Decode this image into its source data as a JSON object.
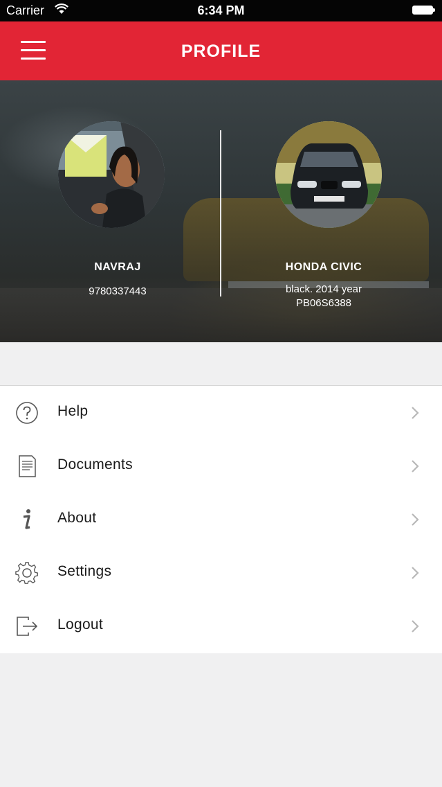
{
  "status_bar": {
    "carrier": "Carrier",
    "time": "6:34 PM"
  },
  "header": {
    "title": "PROFILE"
  },
  "profile": {
    "driver_name": "NAVRAJ",
    "driver_phone": "9780337443",
    "car_name": "HONDA CIVIC",
    "car_description": "black. 2014 year",
    "car_plate": "PB06S6388"
  },
  "menu": {
    "items": [
      {
        "label": "Help",
        "icon": "help-icon"
      },
      {
        "label": "Documents",
        "icon": "document-icon"
      },
      {
        "label": "About",
        "icon": "info-icon"
      },
      {
        "label": "Settings",
        "icon": "gear-icon"
      },
      {
        "label": "Logout",
        "icon": "logout-icon"
      }
    ]
  },
  "colors": {
    "accent": "#e22535",
    "status_bar": "#050505",
    "background": "#f0f0f1"
  }
}
